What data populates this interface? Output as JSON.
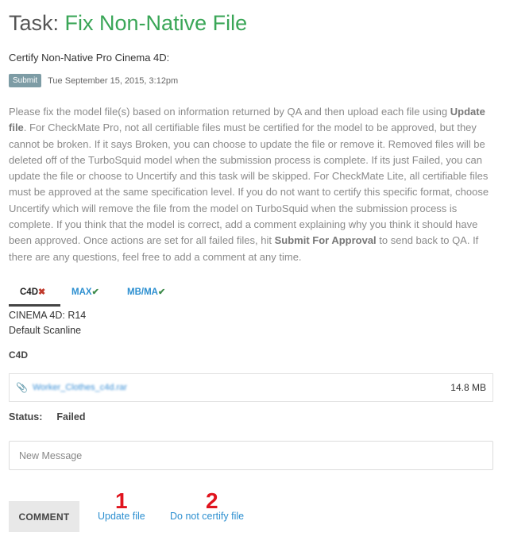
{
  "header": {
    "title_prefix": "Task:",
    "title_name": "Fix Non-Native File",
    "subtitle": "Certify Non-Native Pro Cinema 4D:",
    "badge": "Submit",
    "date": "Tue September 15, 2015, 3:12pm"
  },
  "instructions": {
    "p1": "Please fix the model file(s) based on information returned by QA and then upload each file using ",
    "b1": "Update file",
    "p2": ". For CheckMate Pro, not all certifiable files must be certified for the model to be approved, but they cannot be broken. If it says Broken, you can choose to update the file or remove it. Removed files will be deleted off of the TurboSquid model when the submission process is complete. If its just Failed, you can update the file or choose to Uncertify and this task will be skipped. For CheckMate Lite, all certifiable files must be approved at the same specification level. If you do not want to certify this specific format, choose Uncertify which will remove the file from the model on TurboSquid when the submission process is complete. If you think that the model is correct, add a comment explaining why you think it should have been approved. Once actions are set for all failed files, hit ",
    "b2": "Submit For Approval",
    "p3": " to send back to QA. If there are any questions, feel free to add a comment at any time."
  },
  "tabs": [
    {
      "label": "C4D",
      "mark": "✖",
      "state": "failed"
    },
    {
      "label": "MAX",
      "mark": "✔",
      "state": "passed"
    },
    {
      "label": "MB/MA",
      "mark": "✔",
      "state": "passed"
    }
  ],
  "specs": {
    "line1": "CINEMA 4D: R14",
    "line2": "Default Scanline"
  },
  "file": {
    "section_label": "C4D",
    "name": "Worker_Clothes_c4d.rar",
    "size": "14.8 MB"
  },
  "status": {
    "label": "Status:",
    "value": "Failed"
  },
  "message": {
    "placeholder": "New Message"
  },
  "actions": {
    "comment": "COMMENT",
    "update": "Update file",
    "uncertify": "Do not certify file"
  },
  "annotations": {
    "one": "1",
    "two": "2"
  },
  "colors": {
    "title_green": "#3aa657",
    "link_blue": "#2c8fd0",
    "badge": "#7d9ca5",
    "fail_red": "#c0392b",
    "pass_green": "#3c8a4a",
    "annotation_red": "#e0141e"
  }
}
